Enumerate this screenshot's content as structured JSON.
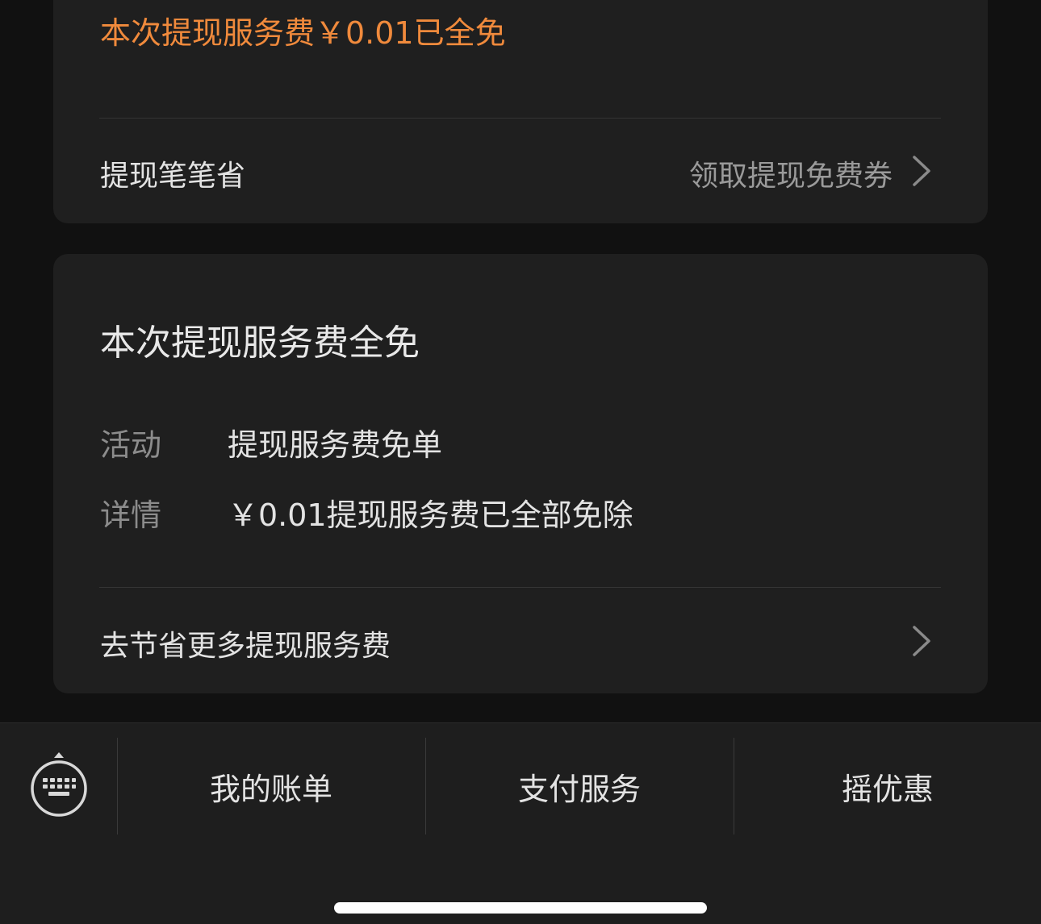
{
  "fee_card": {
    "fee_text": "本次提现服务费￥0.01已全免",
    "savings_label": "提现笔笔省",
    "coupon_link": "领取提现免费券"
  },
  "waiver_card": {
    "title": "本次提现服务费全免",
    "activity_key": "活动",
    "activity_value": "提现服务费免单",
    "detail_key": "详情",
    "detail_value": "￥0.01提现服务费已全部免除",
    "save_more_link": "去节省更多提现服务费"
  },
  "bottom_menu": {
    "keyboard_icon": "keyboard-icon",
    "items": [
      {
        "label": "我的账单"
      },
      {
        "label": "支付服务"
      },
      {
        "label": "摇优惠"
      }
    ]
  },
  "colors": {
    "accent_orange": "#f08a3c",
    "background": "#111111",
    "card": "#1f1f1f"
  }
}
